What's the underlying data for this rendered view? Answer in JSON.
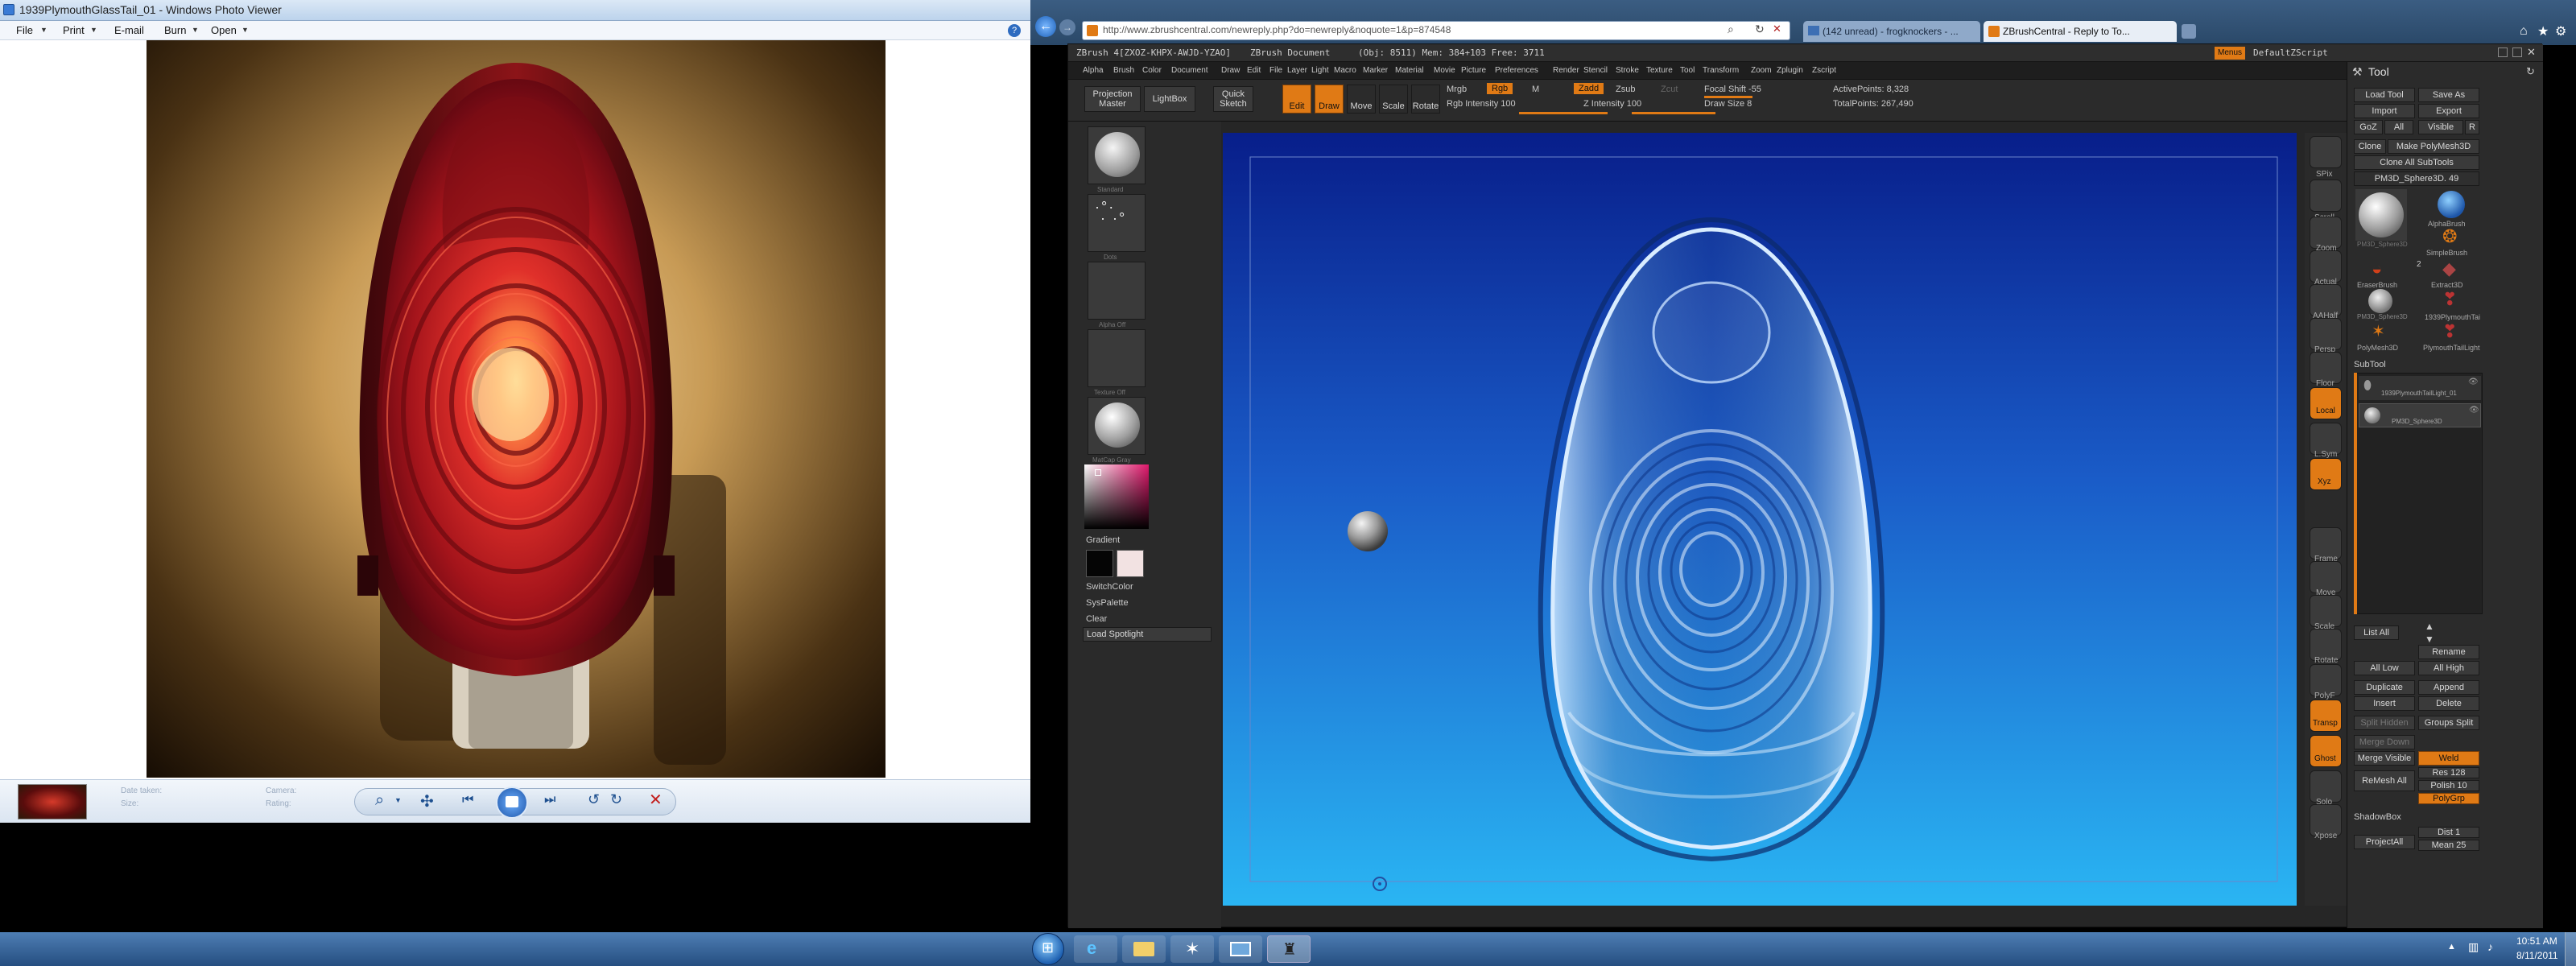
{
  "photo_viewer": {
    "title": "1939PlymouthGlassTail_01 - Windows Photo Viewer",
    "menu": [
      "File",
      "Print",
      "E-mail",
      "Burn",
      "Open"
    ],
    "photo_caption": "1939 Plymouth red glass tail light lens lit from within",
    "info_labels": [
      "Date taken:",
      "Size:",
      "Camera:",
      "Rating:"
    ]
  },
  "browser": {
    "url": "http://www.zbrushcentral.com/newreply.php?do=newreply&noquote=1&p=874548",
    "tabs": [
      "(142 unread) - frogknockers - ...",
      "ZBrushCentral - Reply to To..."
    ]
  },
  "zbrush": {
    "title": "ZBrush 4[ZXOZ-KHPX-AWJD-YZAO]",
    "doc": "ZBrush Document",
    "stats": "(Obj: 8511)  Mem: 384+103  Free: 3711",
    "menu": [
      "Alpha",
      "Brush",
      "Color",
      "Document",
      "Draw",
      "Edit",
      "File",
      "Layer",
      "Light",
      "Macro",
      "Marker",
      "Material",
      "Movie",
      "Picture",
      "Preferences",
      "Render",
      "Stencil",
      "Stroke",
      "Texture",
      "Tool",
      "Transform",
      "Zoom",
      "Zplugin",
      "Zscript"
    ],
    "menus_btn": "Menus",
    "zscript": "DefaultZScript",
    "shelf": {
      "projection": "Projection\nMaster",
      "lightbox": "LightBox",
      "quick_sketch": "Quick\nSketch",
      "edit": "Edit",
      "draw": "Draw",
      "move": "Move",
      "scale": "Scale",
      "rotate": "Rotate",
      "mrgb": "Mrgb",
      "rgb": "Rgb",
      "m": "M",
      "zadd": "Zadd",
      "zsub": "Zsub",
      "zcut": "Zcut",
      "rgb_intensity": "Rgb Intensity 100",
      "z_intensity": "Z Intensity 100",
      "focal_shift": "Focal Shift -55",
      "draw_size": "Draw Size 8",
      "active_points": "ActivePoints: 8,328",
      "total_points": "TotalPoints: 267,490"
    },
    "left": {
      "gradient": "Gradient",
      "switch_color": "SwitchColor",
      "sys_palette": "SysPalette",
      "clear": "Clear",
      "load_spotlight": "Load Spotlight",
      "thumb_labels": [
        "Standard",
        "Dots",
        "Alpha Off",
        "Texture Off",
        "MatCap Gray"
      ]
    },
    "right_tools": [
      "SPix",
      "Scroll",
      "Zoom",
      "Actual",
      "AAHalf",
      "Persp",
      "Floor",
      "Local",
      "L.Sym",
      "Xyz",
      "Frame",
      "Move",
      "Scale",
      "Rotate",
      "PolyF",
      "Transp",
      "Ghost",
      "Solo",
      "Xpose"
    ],
    "tool": {
      "header": "Tool",
      "load_tool": "Load Tool",
      "save_as": "Save As",
      "import": "Import",
      "export": "Export",
      "goz": "GoZ",
      "all": "All",
      "visible": "Visible",
      "r": "R",
      "clone": "Clone",
      "make_polymesh": "Make PolyMesh3D",
      "clone_all": "Clone All SubTools",
      "current": "PM3D_Sphere3D. 49",
      "grid_items": [
        "PM3D_Sphere3D",
        "AlphaBrush",
        "SimpleBrush",
        "EraserBrush",
        "Extract3D",
        "PM3D_Sphere3D",
        "1939PlymouthTai",
        "PolyMesh3D",
        "PlymouthTailLight"
      ],
      "badges": [
        "2"
      ],
      "subtool_header": "SubTool",
      "subtools": [
        "1939PlymouthTailLight_01",
        "PM3D_Sphere3D"
      ],
      "list_all": "List All",
      "rename": "Rename",
      "all_low": "All Low",
      "all_high": "All High",
      "duplicate": "Duplicate",
      "append": "Append",
      "insert": "Insert",
      "delete": "Delete",
      "split_hidden": "Split Hidden",
      "groups_split": "Groups Split",
      "merge_down": "Merge Down",
      "merge_visible": "Merge Visible",
      "weld": "Weld",
      "remesh_all": "ReMesh All",
      "res": "Res 128",
      "polish": "Polish 10",
      "polygrp": "PolyGrp",
      "shadowbox": "ShadowBox",
      "project_all": "ProjectAll",
      "dist": "Dist 1",
      "mean": "Mean 25"
    }
  },
  "taskbar": {
    "time": "10:51 AM",
    "date": "8/11/2011"
  },
  "colors": {
    "accent": "#e07a15",
    "canvas_top": "#081e8a",
    "canvas_bottom": "#2ab5f3",
    "lens_red": "#d32622"
  }
}
